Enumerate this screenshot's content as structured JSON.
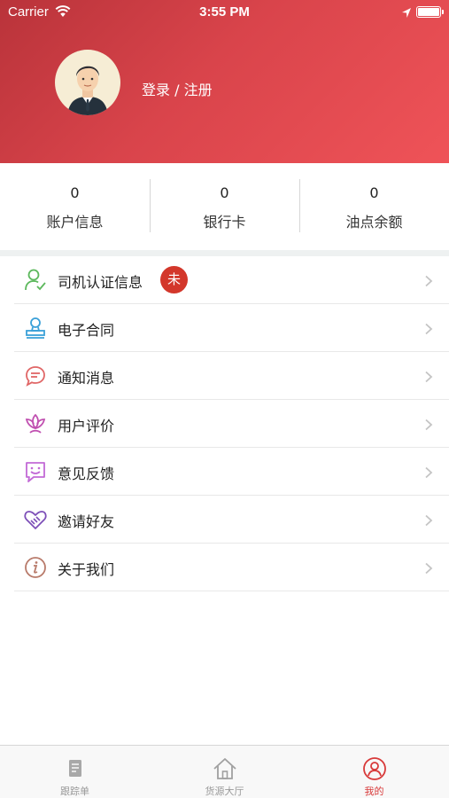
{
  "status_bar": {
    "carrier": "Carrier",
    "time": "3:55 PM"
  },
  "header": {
    "login_label": "登录 / 注册"
  },
  "stats": [
    {
      "value": "0",
      "label": "账户信息"
    },
    {
      "value": "0",
      "label": "银行卡"
    },
    {
      "value": "0",
      "label": "油点余额"
    }
  ],
  "menu": [
    {
      "label": "司机认证信息",
      "icon": "driver-verify-icon",
      "badge": "未"
    },
    {
      "label": "电子合同",
      "icon": "contract-stamp-icon"
    },
    {
      "label": "通知消息",
      "icon": "message-bubble-icon"
    },
    {
      "label": "用户评价",
      "icon": "lotus-icon"
    },
    {
      "label": "意见反馈",
      "icon": "feedback-smile-icon"
    },
    {
      "label": "邀请好友",
      "icon": "handshake-heart-icon"
    },
    {
      "label": "关于我们",
      "icon": "info-icon"
    }
  ],
  "tabbar": {
    "active": "我的",
    "tabs": [
      {
        "label": "跟踪单",
        "icon": "document-icon"
      },
      {
        "label": "货源大厅",
        "icon": "house-icon"
      },
      {
        "label": "我的",
        "icon": "person-circle-icon"
      }
    ]
  },
  "colors": {
    "header_start": "#b9333a",
    "header_end": "#ef5358",
    "badge": "#d3372b",
    "active_tab": "#d83a3a"
  }
}
